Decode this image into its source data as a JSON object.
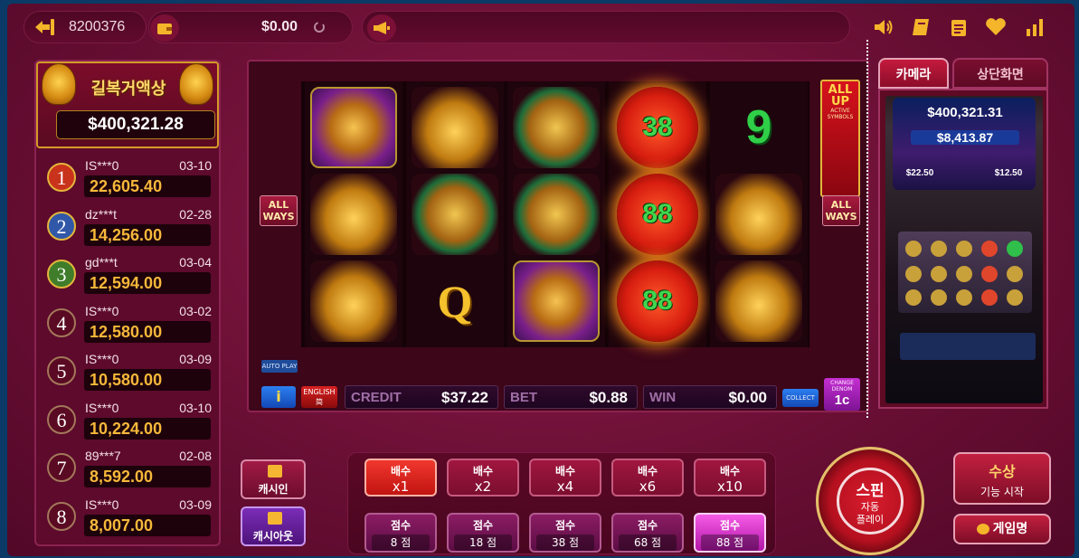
{
  "topbar": {
    "user_id": "8200376",
    "balance": "$0.00",
    "icons": [
      "exit-icon",
      "wallet-icon",
      "refresh-icon",
      "megaphone-icon",
      "speaker-icon",
      "book-icon",
      "notepad-icon",
      "heart-icon",
      "stats-icon"
    ]
  },
  "jackpot": {
    "title": "길복거액상",
    "amount": "$400,321.28"
  },
  "leaderboard": [
    {
      "rank": "1",
      "user": "IS***0",
      "date": "03-10",
      "amount": "22,605.40"
    },
    {
      "rank": "2",
      "user": "dz***t",
      "date": "02-28",
      "amount": "14,256.00"
    },
    {
      "rank": "3",
      "user": "gd***t",
      "date": "03-04",
      "amount": "12,594.00"
    },
    {
      "rank": "4",
      "user": "IS***0",
      "date": "03-02",
      "amount": "12,580.00"
    },
    {
      "rank": "5",
      "user": "IS***0",
      "date": "03-09",
      "amount": "10,580.00"
    },
    {
      "rank": "6",
      "user": "IS***0",
      "date": "03-10",
      "amount": "10,224.00"
    },
    {
      "rank": "7",
      "user": "89***7",
      "date": "02-08",
      "amount": "8,592.00"
    },
    {
      "rank": "8",
      "user": "IS***0",
      "date": "03-09",
      "amount": "8,007.00"
    }
  ],
  "game": {
    "all_ways_label": "ALL WAYS",
    "allup_title": "ALL UP",
    "allup_sub": "ACTIVE SYMBOLS",
    "autoplay_label": "AUTO PLAY",
    "info_label": "i",
    "lang_label": "ENGLISH 简",
    "credit_label": "CREDIT",
    "credit_value": "$37.22",
    "bet_label": "BET",
    "bet_value": "$0.88",
    "win_label": "WIN",
    "win_value": "$0.00",
    "collect_label": "COLLECT",
    "denom_label": "CHANGE DENOM",
    "denom_value": "1c",
    "reels": [
      [
        "phoenix",
        "fish",
        "fish"
      ],
      [
        "fish",
        "turtle",
        "Q"
      ],
      [
        "turtle",
        "turtle",
        "phoenix"
      ],
      [
        "38",
        "88",
        "88"
      ],
      [
        "9",
        "fish",
        "fish"
      ]
    ]
  },
  "right_panel": {
    "tab_camera": "카메라",
    "tab_top_screen": "상단화면",
    "cam_jackpot": "$400,321.31",
    "cam_major": "$8,413.87",
    "cam_left": "$22.50",
    "cam_right": "$12.50"
  },
  "controls": {
    "cash_in": "캐시인",
    "cash_out": "캐시아웃",
    "multipliers": [
      {
        "top": "배수",
        "bot": "x1",
        "active": true
      },
      {
        "top": "배수",
        "bot": "x2",
        "active": false
      },
      {
        "top": "배수",
        "bot": "x4",
        "active": false
      },
      {
        "top": "배수",
        "bot": "x6",
        "active": false
      },
      {
        "top": "배수",
        "bot": "x10",
        "active": false
      }
    ],
    "scores": [
      {
        "top": "점수",
        "bot": "8 점",
        "active": false
      },
      {
        "top": "점수",
        "bot": "18 점",
        "active": false
      },
      {
        "top": "점수",
        "bot": "38 점",
        "active": false
      },
      {
        "top": "점수",
        "bot": "68 점",
        "active": false
      },
      {
        "top": "점수",
        "bot": "88 점",
        "active": true
      }
    ],
    "spin_main": "스핀",
    "spin_auto": "자동",
    "spin_play": "플레이",
    "bonus_top": "수상",
    "bonus_bot": "기능 시작",
    "games": "게임명"
  },
  "colors": {
    "accent_gold": "#f4b52a",
    "bg_maroon": "#6b0f35"
  }
}
